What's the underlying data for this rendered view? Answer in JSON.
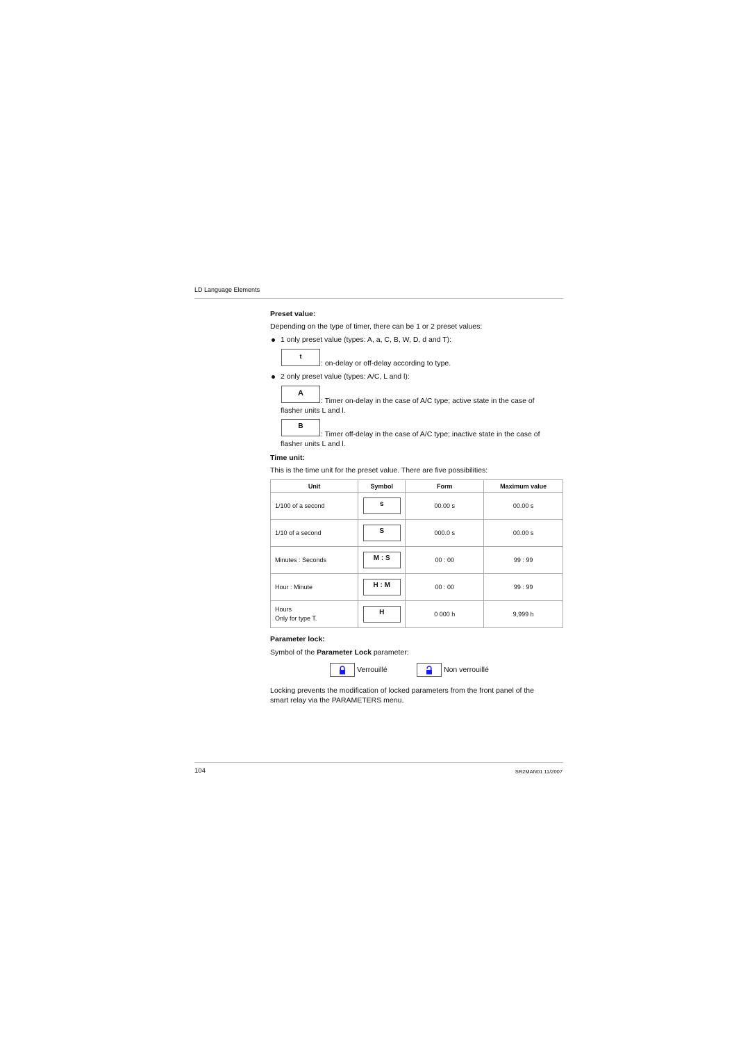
{
  "header": {
    "section": "LD Language Elements"
  },
  "preset": {
    "heading": "Preset value:",
    "intro": "Depending on the type of timer, there can be 1 or 2 preset values:",
    "bullet1": "1 only preset value (types: A, a, C, B, W, D, d and T):",
    "box_t": "t",
    "desc_t": ": on-delay or off-delay according to type.",
    "bullet2": "2 only preset value (types: A/C, L and l):",
    "box_a": "A",
    "desc_a_line1": ": Timer on-delay in the case of A/C type; active state in the case of",
    "desc_a_line2": "flasher units L and l.",
    "box_b": "B",
    "desc_b_line1": ": Timer off-delay in the case of A/C type; inactive state in the case of",
    "desc_b_line2": "flasher units L and l."
  },
  "time_unit": {
    "heading": "Time unit:",
    "intro": "This is the time unit for the preset value. There are five possibilities:",
    "columns": [
      "Unit",
      "Symbol",
      "Form",
      "Maximum value"
    ],
    "rows": [
      {
        "unit": "1/100 of a second",
        "unit2": "",
        "symbol": "s",
        "form": "00.00 s",
        "max": "00.00 s"
      },
      {
        "unit": "1/10 of a second",
        "unit2": "",
        "symbol": "S",
        "form": "000.0 s",
        "max": "00.00 s"
      },
      {
        "unit": "Minutes : Seconds",
        "unit2": "",
        "symbol": "M : S",
        "form": "00 : 00",
        "max": "99 : 99"
      },
      {
        "unit": "Hour : Minute",
        "unit2": "",
        "symbol": "H : M",
        "form": "00 : 00",
        "max": "99 : 99"
      },
      {
        "unit": "Hours",
        "unit2": "Only for type T.",
        "symbol": "H",
        "form": "0 000 h",
        "max": "9,999 h"
      }
    ]
  },
  "param_lock": {
    "heading": "Parameter lock:",
    "intro_prefix": "Symbol of the ",
    "intro_bold": "Parameter Lock",
    "intro_suffix": " parameter:",
    "locked_label": "Verrouillé",
    "unlocked_label": "Non verrouillé",
    "lock_color": "#1a1aff",
    "note_line1": "Locking prevents the modification of locked parameters from the front panel of the",
    "note_line2": "smart relay via the PARAMETERS menu."
  },
  "footer": {
    "page_number": "104",
    "doc_ref": "SR2MAN01 11/2007"
  }
}
